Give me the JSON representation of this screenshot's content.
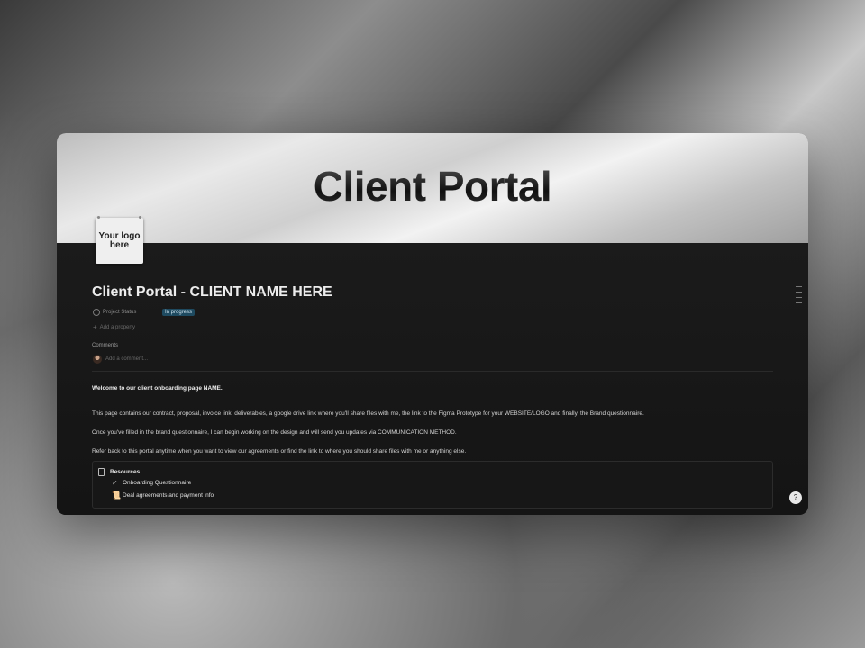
{
  "cover": {
    "title": "Client Portal"
  },
  "logo": {
    "text": "Your logo\nhere"
  },
  "page": {
    "title": "Client Portal - CLIENT NAME HERE",
    "property": {
      "label": "Project Status",
      "value": "In progress"
    },
    "add_property": "Add a property",
    "comments": {
      "label": "Comments",
      "placeholder": "Add a comment..."
    },
    "paragraphs": [
      "Welcome to our client onboarding page NAME.",
      "This page contains our contract, proposal, invoice link, deliverables, a google drive link where you'll share files with me, the link to the Figma Prototype for your WEBSITE/LOGO and finally, the Brand questionnaire.",
      "Once you've filled in the brand questionnaire, I can begin working on the design and will send you updates via COMMUNICATION METHOD.",
      "Refer back to this portal anytime when you want to view our agreements or find the link to where you should share files with me or anything else."
    ],
    "resources": {
      "title": "Resources",
      "items": [
        {
          "icon": "check-icon",
          "label": "Onboarding Questionnaire"
        },
        {
          "icon": "scroll-icon",
          "label": "Deal agreements and payment info"
        }
      ]
    },
    "help_label": "?"
  },
  "colors": {
    "status_badge_bg": "#1e4a60",
    "page_bg": "#151515"
  }
}
